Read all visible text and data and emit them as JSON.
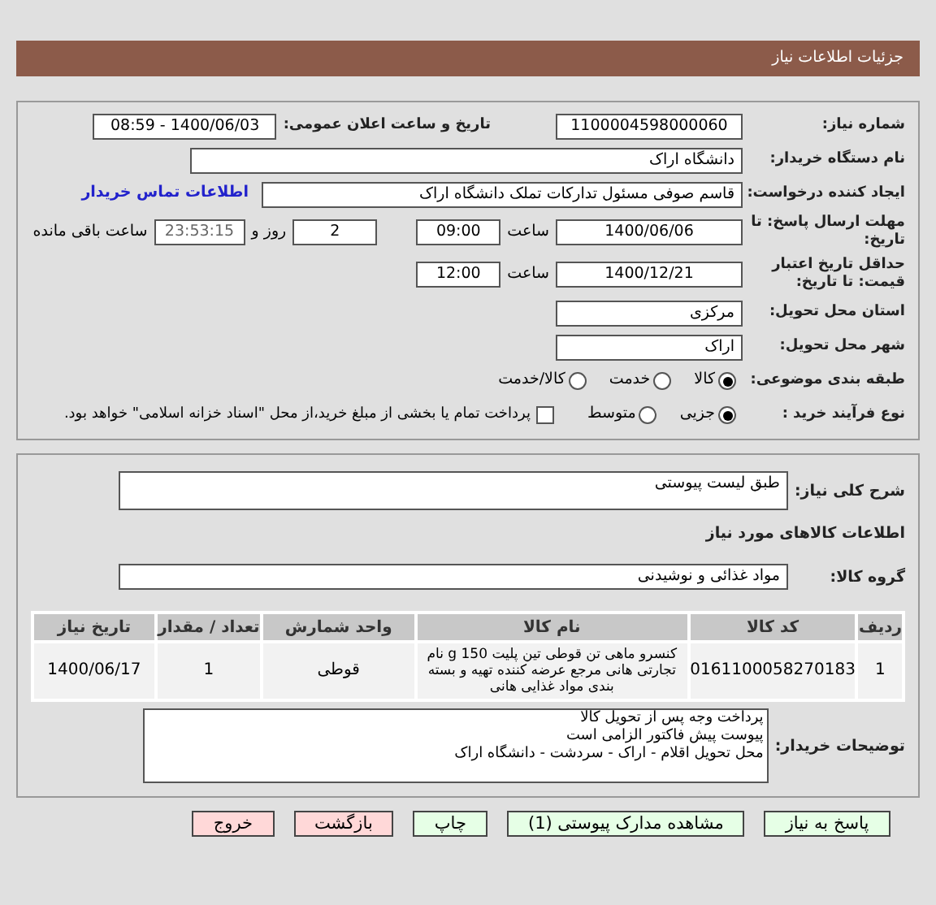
{
  "header": {
    "title": "جزئیات اطلاعات نیاز"
  },
  "need_number": {
    "label": "شماره نیاز:",
    "value": "1100004598000060"
  },
  "announce": {
    "label": "تاریخ و ساعت اعلان عمومی:",
    "value": "1400/06/03 - 08:59"
  },
  "buyer_org": {
    "label": "نام دستگاه خریدار:",
    "value": "دانشگاه اراک"
  },
  "creator": {
    "label": "ایجاد کننده درخواست:",
    "value": "قاسم صوفی مسئول تدارکات تملک دانشگاه اراک",
    "link": "اطلاعات تماس خریدار"
  },
  "deadline": {
    "label": "مهلت ارسال پاسخ: تا تاریخ:",
    "date": "1400/06/06",
    "time_label": "ساعت",
    "time": "09:00",
    "days": "2",
    "days_label": "روز و",
    "remaining": "23:53:15",
    "remaining_label": "ساعت باقی مانده"
  },
  "price_validity": {
    "label": "حداقل تاریخ اعتبار قیمت: تا تاریخ:",
    "date": "1400/12/21",
    "time_label": "ساعت",
    "time": "12:00"
  },
  "province": {
    "label": "استان محل تحویل:",
    "value": "مرکزی"
  },
  "city": {
    "label": "شهر محل تحویل:",
    "value": "اراک"
  },
  "category": {
    "label": "طبقه بندی موضوعی:",
    "options": [
      {
        "label": "کالا",
        "selected": true
      },
      {
        "label": "خدمت",
        "selected": false
      },
      {
        "label": "کالا/خدمت",
        "selected": false
      }
    ]
  },
  "purchase_type": {
    "label": "نوع فرآیند خرید :",
    "options": [
      {
        "label": "جزیی",
        "selected": true
      },
      {
        "label": "متوسط",
        "selected": false
      }
    ],
    "payment_note": {
      "label": "پرداخت تمام یا بخشی از مبلغ خرید،از محل \"اسناد خزانه اسلامی\" خواهد بود.",
      "checked": false
    }
  },
  "description": {
    "label": "شرح کلی نیاز:",
    "value": "طبق لیست پیوستی"
  },
  "items_title": "اطلاعات کالاهای مورد نیاز",
  "goods_group": {
    "label": "گروه کالا:",
    "value": "مواد غذائی و نوشیدنی"
  },
  "table": {
    "columns": [
      "ردیف",
      "کد کالا",
      "نام کالا",
      "واحد شمارش",
      "تعداد / مقدار",
      "تاریخ نیاز"
    ],
    "rows": [
      [
        "1",
        "0161100058270183",
        "کنسرو ماهی تن قوطی تین پلیت 150 g نام تجارتی هانی مرجع عرضه کننده تهیه و بسته بندی مواد غذایی هانی",
        "قوطی",
        "1",
        "1400/06/17"
      ]
    ]
  },
  "buyer_notes": {
    "label": "توضیحات خریدار:",
    "lines": [
      "پرداخت وجه پس از تحویل کالا",
      "پیوست پیش فاکتور الزامی است",
      "محل تحویل اقلام - اراک - سردشت - دانشگاه اراک"
    ]
  },
  "buttons": [
    {
      "label": "پاسخ به نیاز",
      "kind": "green"
    },
    {
      "label": "مشاهده مدارک پیوستی (1)",
      "kind": "green"
    },
    {
      "label": "چاپ",
      "kind": "green"
    },
    {
      "label": "بازگشت",
      "kind": "red"
    },
    {
      "label": "خروج",
      "kind": "red"
    }
  ]
}
